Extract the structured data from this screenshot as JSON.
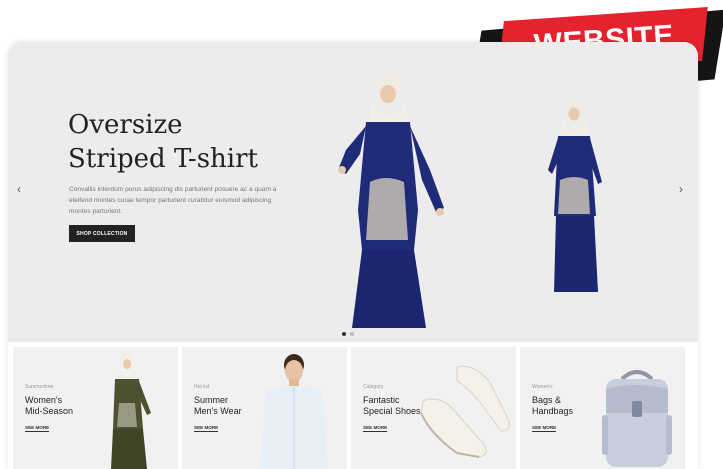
{
  "badge": {
    "label": "WEBSITE"
  },
  "hero": {
    "title": "Oversize\nStriped T-shirt",
    "description": "Convallis interdum purus adipiscing dis parturient posuere ac a quam a eleifend montes curae tempor parturient curabitur euismod adipiscing montes parturient.",
    "button_label": "SHOP COLLECTION",
    "prev_icon": "chevron-left-icon",
    "next_icon": "chevron-right-icon",
    "slide_count": 2,
    "active_slide": 1
  },
  "cards": [
    {
      "category": "Summertime",
      "name": "Women's\nMid-Season",
      "link": "SEE MORE"
    },
    {
      "category": "Hot list",
      "name": "Summer\nMen's Wear",
      "link": "SEE MORE"
    },
    {
      "category": "Category",
      "name": "Fantastic\nSpecial Shoes",
      "link": "SEE MORE"
    },
    {
      "category": "Women's",
      "name": "Bags &\nHandbags",
      "link": "SEE MORE"
    }
  ],
  "colors": {
    "accent": "#e5232e",
    "navy_dress": "#1f2a78",
    "olive_dress": "#4a5230",
    "button": "#222222"
  }
}
